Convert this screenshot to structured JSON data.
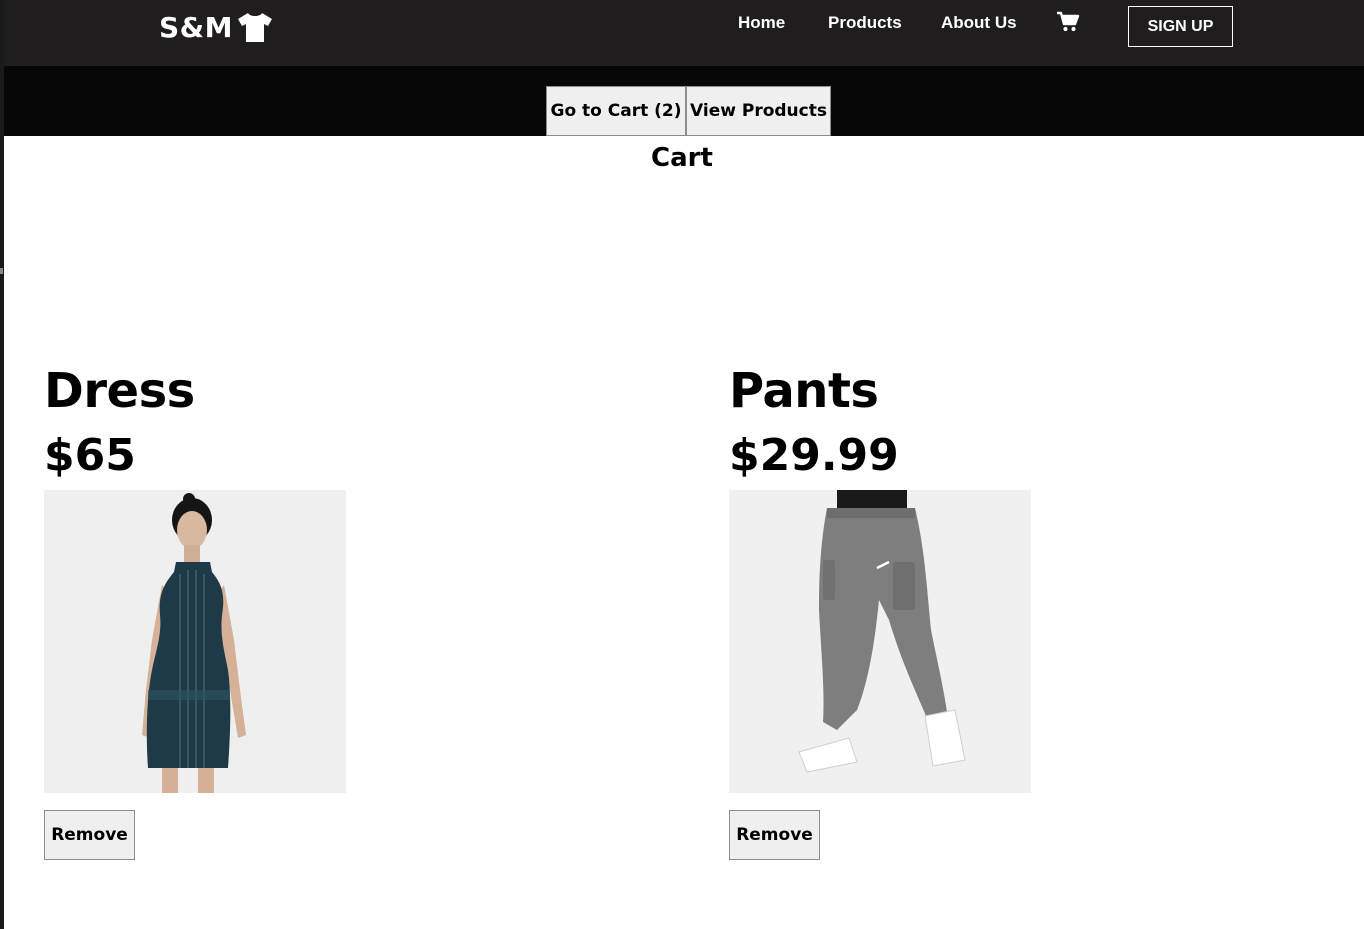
{
  "brand": {
    "name": "S&M",
    "icon": "tshirt-icon"
  },
  "nav": {
    "home": "Home",
    "products": "Products",
    "about": "About Us",
    "cart_icon": "shopping-cart-icon",
    "signup": "SIGN UP"
  },
  "subnav": {
    "go_to_cart": "Go to Cart (2)",
    "view_products": "View Products"
  },
  "page_title": "Cart",
  "items": [
    {
      "name": "Dress",
      "price": "$65",
      "remove_label": "Remove",
      "image": "dress-photo"
    },
    {
      "name": "Pants",
      "price": "$29.99",
      "remove_label": "Remove",
      "image": "pants-photo"
    }
  ],
  "colors": {
    "navbar": "#1f1d1d",
    "subbar": "#060606",
    "button_bg": "#efefef",
    "button_border": "#8d8d8d",
    "dress": "#1e3a46",
    "pants": "#7e7e7e"
  }
}
